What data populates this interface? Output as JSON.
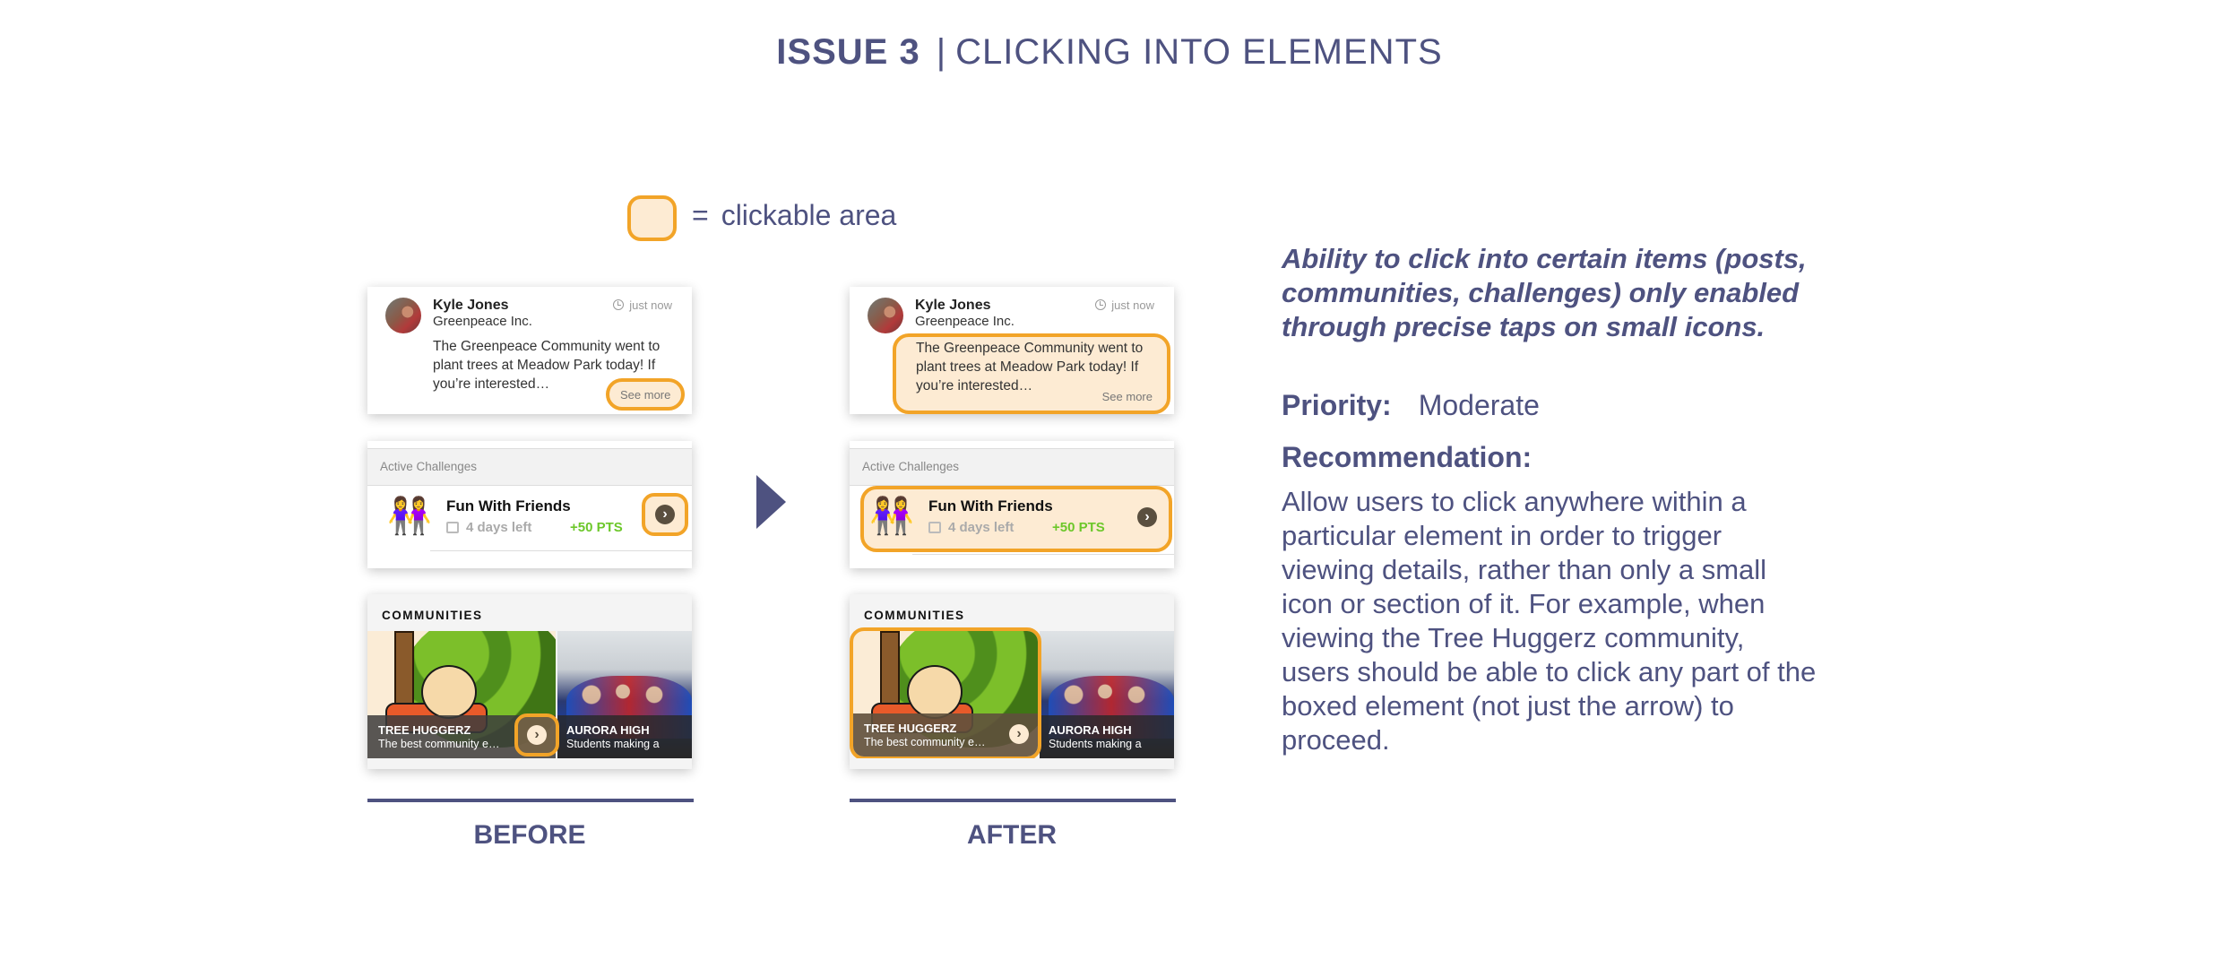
{
  "title": {
    "issue": "ISSUE 3",
    "separator": "|",
    "topic": "CLICKING INTO ELEMENTS"
  },
  "legend": {
    "equals": "=",
    "label": "clickable area"
  },
  "colors": {
    "primary": "#4e5280",
    "highlight_border": "#f2a428",
    "highlight_fill": "#fdebd3",
    "points_green": "#6cc72a"
  },
  "post": {
    "author": "Kyle Jones",
    "organization": "Greenpeace Inc.",
    "time": "just now",
    "body": "The Greenpeace Community went to plant trees at Meadow Park today! If you’re interested…",
    "see_more": "See more"
  },
  "challenges": {
    "header": "Active Challenges",
    "item": {
      "emoji": "👭",
      "name": "Fun With Friends",
      "days_left": "4 days left",
      "points": "+50 PTS",
      "chevron": "›"
    }
  },
  "communities": {
    "header": "COMMUNITIES",
    "items": [
      {
        "name": "TREE HUGGERZ",
        "description": "The best community e…",
        "chevron": "›"
      },
      {
        "name": "AURORA HIGH",
        "description": "Students making a"
      }
    ]
  },
  "labels": {
    "before": "BEFORE",
    "after": "AFTER"
  },
  "finding": {
    "headline": "Ability to click into certain items (posts, communities, challenges) only enabled through precise taps on small icons.",
    "priority_label": "Priority:",
    "priority_value": "Moderate",
    "recommendation_label": "Recommendation:",
    "recommendation_body": "Allow users to click anywhere within a particular element in order to trigger viewing details, rather than only a small icon or section of it. For example, when viewing the Tree Huggerz community, users should be able to click any part of the boxed element (not just the arrow) to proceed."
  }
}
